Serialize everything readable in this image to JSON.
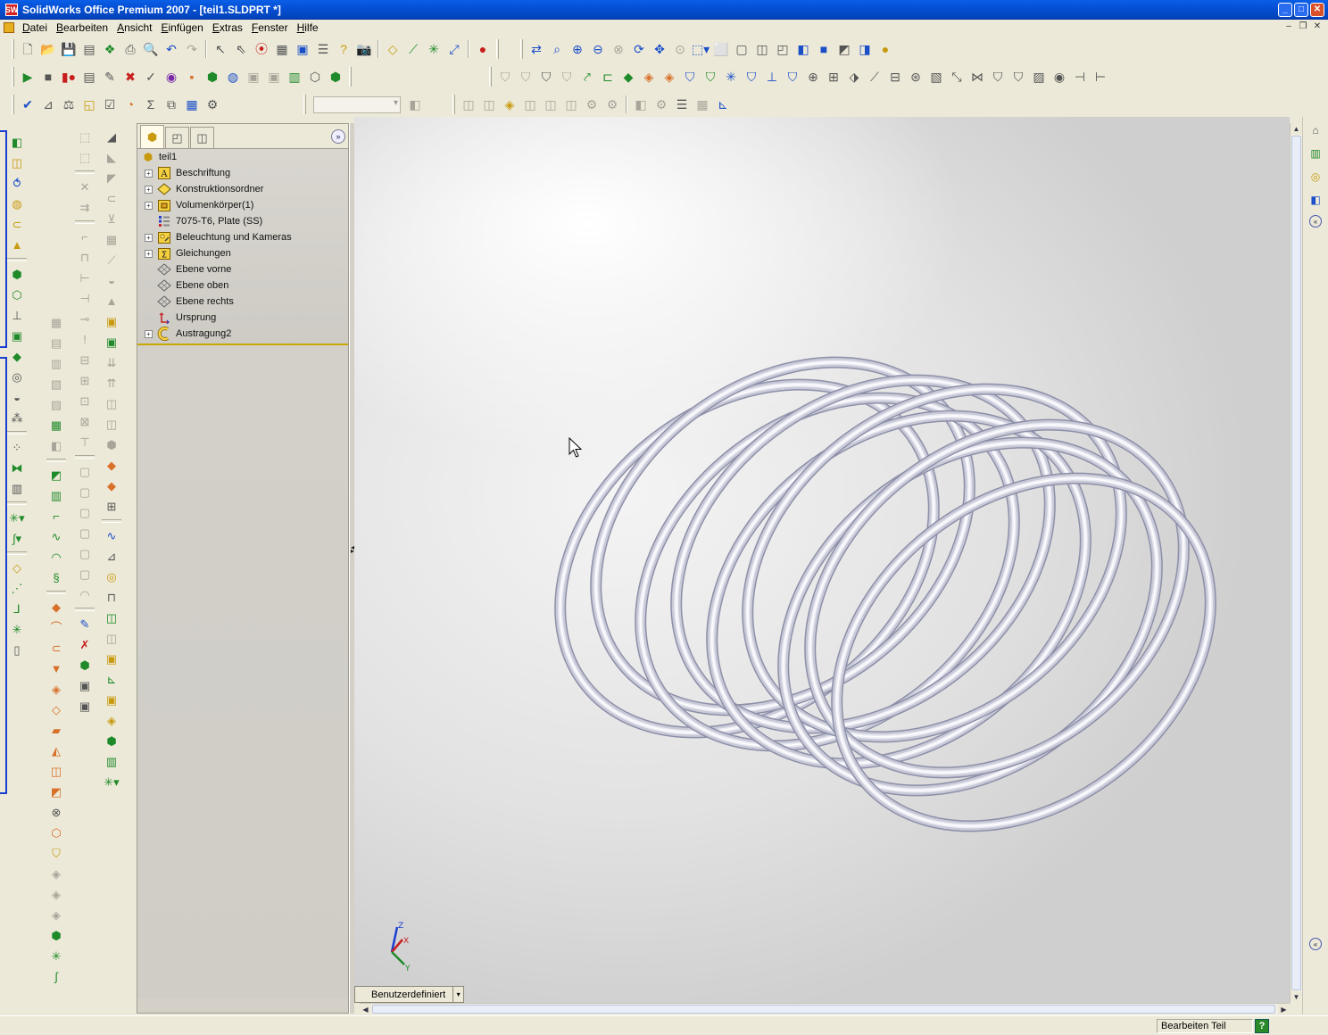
{
  "window": {
    "title": "SolidWorks Office Premium 2007 - [teil1.SLDPRT *]",
    "logo": "SW"
  },
  "menu": {
    "items": [
      {
        "u": "D",
        "rest": "atei"
      },
      {
        "u": "B",
        "rest": "earbeiten"
      },
      {
        "u": "A",
        "rest": "nsicht"
      },
      {
        "u": "E",
        "rest": "infügen"
      },
      {
        "u": "E",
        "rest": "xtras"
      },
      {
        "u": "F",
        "rest": "enster"
      },
      {
        "u": "H",
        "rest": "ilfe"
      }
    ]
  },
  "feature_manager": {
    "root": "teil1",
    "items": [
      {
        "label": "Beschriftung",
        "icon": "annotation-icon",
        "expandable": true
      },
      {
        "label": "Konstruktionsordner",
        "icon": "design-folder-icon",
        "expandable": true
      },
      {
        "label": "Volumenkörper(1)",
        "icon": "solid-bodies-icon",
        "expandable": true
      },
      {
        "label": "7075-T6, Plate (SS)",
        "icon": "material-icon",
        "expandable": false
      },
      {
        "label": "Beleuchtung und Kameras",
        "icon": "lights-cameras-icon",
        "expandable": true
      },
      {
        "label": "Gleichungen",
        "icon": "equations-icon",
        "expandable": true
      },
      {
        "label": "Ebene vorne",
        "icon": "plane-icon",
        "expandable": false
      },
      {
        "label": "Ebene oben",
        "icon": "plane-icon",
        "expandable": false
      },
      {
        "label": "Ebene rechts",
        "icon": "plane-icon",
        "expandable": false
      },
      {
        "label": "Ursprung",
        "icon": "origin-icon",
        "expandable": false
      },
      {
        "label": "Austragung2",
        "icon": "sweep-feature-icon",
        "expandable": true
      }
    ]
  },
  "viewport": {
    "view_orientation": "Benutzerdefiniert",
    "triad": {
      "z": "Z",
      "x": "X",
      "y": "Y"
    }
  },
  "status": {
    "mode": "Bearbeiten Teil",
    "help": "?"
  },
  "colors": {
    "title_bar": "#0550D6",
    "spring": "#e4e4ee",
    "rollback_bar": "#c8a800"
  }
}
